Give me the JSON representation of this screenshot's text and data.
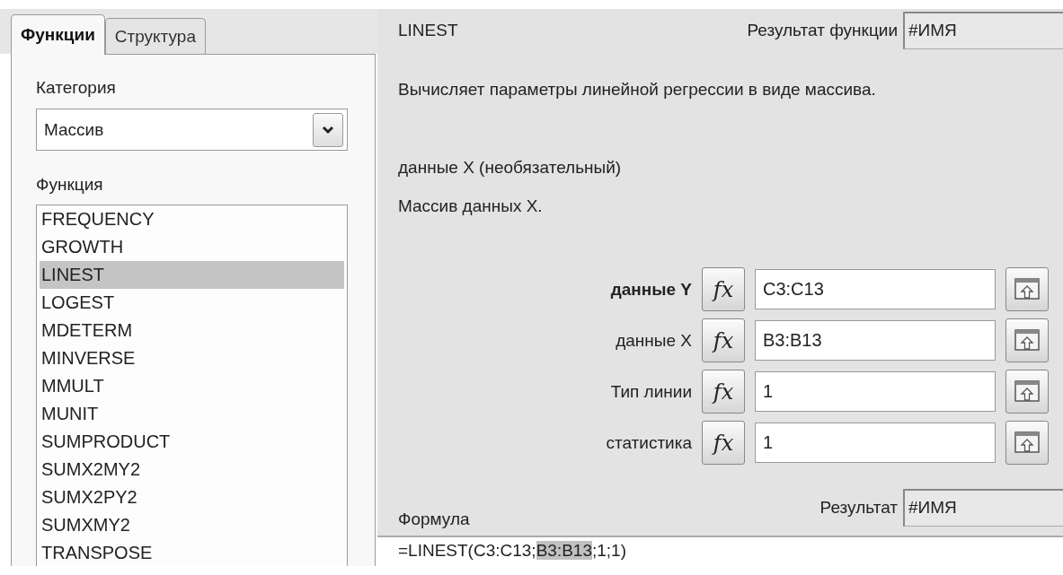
{
  "tabs": [
    {
      "label": "Функции",
      "selected": true
    },
    {
      "label": "Структура",
      "selected": false
    }
  ],
  "category": {
    "label": "Категория",
    "value": "Массив"
  },
  "function_list": {
    "label": "Функция",
    "items": [
      {
        "label": "FREQUENCY",
        "selected": false
      },
      {
        "label": "GROWTH",
        "selected": false
      },
      {
        "label": "LINEST",
        "selected": true
      },
      {
        "label": "LOGEST",
        "selected": false
      },
      {
        "label": "MDETERM",
        "selected": false
      },
      {
        "label": "MINVERSE",
        "selected": false
      },
      {
        "label": "MMULT",
        "selected": false
      },
      {
        "label": "MUNIT",
        "selected": false
      },
      {
        "label": "SUMPRODUCT",
        "selected": false
      },
      {
        "label": "SUMX2MY2",
        "selected": false
      },
      {
        "label": "SUMX2PY2",
        "selected": false
      },
      {
        "label": "SUMXMY2",
        "selected": false
      },
      {
        "label": "TRANSPOSE",
        "selected": false
      }
    ]
  },
  "function_name": "LINEST",
  "function_result": {
    "label": "Результат функции",
    "value": "#ИМЯ"
  },
  "description": "Вычисляет параметры линейной регрессии в виде массива.",
  "argument_title": "данные X (необязательный)",
  "argument_description": "Массив данных X.",
  "arguments": [
    {
      "label": "данные Y",
      "required": true,
      "function_button": "fx",
      "value": "C3:C13"
    },
    {
      "label": "данные X",
      "required": false,
      "function_button": "fx",
      "value": "B3:B13"
    },
    {
      "label": "Тип линии",
      "required": false,
      "function_button": "fx",
      "value": "1"
    },
    {
      "label": "статистика",
      "required": false,
      "function_button": "fx",
      "value": "1"
    }
  ],
  "formula": {
    "label": "Формула",
    "segments": [
      {
        "text": "=LINEST(C3:C13;",
        "selected": false
      },
      {
        "text": "B3:B13",
        "selected": true
      },
      {
        "text": ";1;1)",
        "selected": false
      }
    ]
  },
  "result": {
    "label": "Результат",
    "value": "#ИМЯ"
  }
}
